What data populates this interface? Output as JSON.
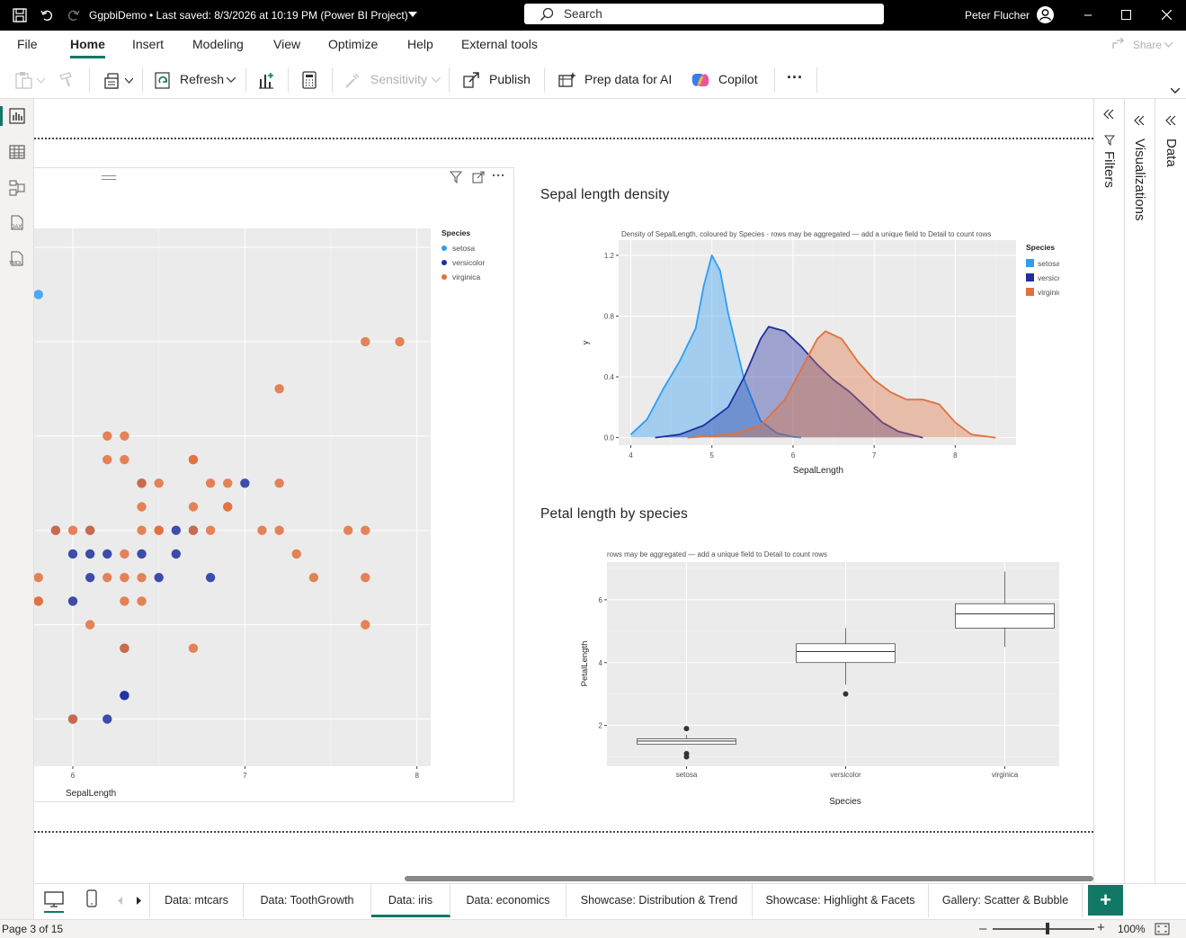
{
  "titlebar": {
    "doc": "GgpbiDemo",
    "saved": "• Last saved: 8/3/2026 at 10:19 PM (Power BI Project)",
    "search_placeholder": "Search",
    "user": "Peter Flucher"
  },
  "menu": {
    "items": [
      "File",
      "Home",
      "Insert",
      "Modeling",
      "View",
      "Optimize",
      "Help",
      "External tools"
    ],
    "share": "Share"
  },
  "ribbon": {
    "refresh": "Refresh",
    "sensitivity": "Sensitivity",
    "publish": "Publish",
    "prep": "Prep data for AI",
    "copilot": "Copilot",
    "more": "···"
  },
  "panes": {
    "filters": "Filters",
    "visualizations": "Visualizations",
    "data": "Data"
  },
  "left_rail": [
    "report-view-icon",
    "table-view-icon",
    "model-view-icon",
    "dax-query-icon",
    "tmdl-view-icon"
  ],
  "visual1": {
    "xlabel": "SepalLength",
    "legend_title": "Species",
    "legend": [
      "setosa",
      "versicolor",
      "virginica"
    ],
    "xticks": [
      "6",
      "7",
      "8"
    ]
  },
  "visual2": {
    "title": "Sepal length density",
    "subtitle": "Density of SepalLength, coloured by Species - rows may be aggregated — add a unique field to Detail to count rows",
    "xlabel": "SepalLength",
    "ylabel": "y",
    "legend_title": "Species",
    "legend": [
      "setosa",
      "versicolor",
      "virginica"
    ]
  },
  "visual3": {
    "title": "Petal length by species",
    "subtitle": "rows may be aggregated — add a unique field to Detail to count rows",
    "xlabel": "Species",
    "ylabel": "PetalLength"
  },
  "colors": {
    "setosa": "#2e9ef4",
    "versicolor": "#1f2fa0",
    "virginica": "#e2703c",
    "panel": "#ebebeb",
    "accent": "#117865"
  },
  "chart_data": [
    {
      "type": "scatter",
      "xlabel": "SepalLength",
      "xlim": [
        5.77,
        8.08
      ],
      "legend_title": "Species",
      "legend_position": "right",
      "series": [
        {
          "name": "setosa",
          "points": [
            [
              5.8,
              4.0
            ]
          ]
        },
        {
          "name": "versicolor",
          "points": [
            [
              6.0,
              2.2
            ],
            [
              6.0,
              2.7
            ],
            [
              6.0,
              2.9
            ],
            [
              6.1,
              2.8
            ],
            [
              6.1,
              2.9
            ],
            [
              6.1,
              3.0
            ],
            [
              6.2,
              2.2
            ],
            [
              6.2,
              2.9
            ],
            [
              6.3,
              2.3
            ],
            [
              6.3,
              2.5
            ],
            [
              6.4,
              2.9
            ],
            [
              6.5,
              2.8
            ],
            [
              6.6,
              2.9
            ],
            [
              6.6,
              3.0
            ],
            [
              6.7,
              3.0
            ],
            [
              6.8,
              2.8
            ],
            [
              7.0,
              3.2
            ],
            [
              5.9,
              3.0
            ],
            [
              6.4,
              3.2
            ],
            [
              6.3,
              2.3
            ]
          ]
        },
        {
          "name": "virginica",
          "points": [
            [
              6.3,
              3.3
            ],
            [
              5.8,
              2.7
            ],
            [
              7.1,
              3.0
            ],
            [
              6.3,
              2.9
            ],
            [
              6.5,
              3.0
            ],
            [
              7.6,
              3.0
            ],
            [
              7.3,
              2.9
            ],
            [
              6.7,
              2.5
            ],
            [
              7.2,
              3.6
            ],
            [
              6.5,
              3.2
            ],
            [
              6.4,
              2.7
            ],
            [
              6.8,
              3.0
            ],
            [
              5.8,
              2.8
            ],
            [
              6.4,
              3.2
            ],
            [
              6.5,
              3.0
            ],
            [
              7.7,
              3.8
            ],
            [
              7.7,
              2.6
            ],
            [
              6.0,
              2.2
            ],
            [
              6.9,
              3.2
            ],
            [
              7.7,
              2.8
            ],
            [
              6.3,
              2.7
            ],
            [
              6.7,
              3.3
            ],
            [
              7.2,
              3.2
            ],
            [
              6.2,
              2.8
            ],
            [
              6.1,
              3.0
            ],
            [
              6.4,
              2.8
            ],
            [
              7.2,
              3.0
            ],
            [
              7.4,
              2.8
            ],
            [
              7.9,
              3.8
            ],
            [
              6.3,
              2.8
            ],
            [
              6.1,
              2.6
            ],
            [
              7.7,
              3.0
            ],
            [
              6.3,
              3.4
            ],
            [
              6.4,
              3.1
            ],
            [
              6.0,
              3.0
            ],
            [
              6.9,
              3.1
            ],
            [
              6.7,
              3.1
            ],
            [
              6.9,
              3.1
            ],
            [
              5.8,
              2.7
            ],
            [
              6.8,
              3.2
            ],
            [
              6.7,
              3.3
            ],
            [
              6.7,
              3.0
            ],
            [
              6.3,
              2.5
            ],
            [
              6.5,
              3.0
            ],
            [
              6.2,
              3.4
            ],
            [
              5.9,
              3.0
            ],
            [
              6.2,
              3.3
            ],
            [
              6.4,
              3.0
            ]
          ]
        }
      ]
    },
    {
      "type": "area",
      "title": "Density of SepalLength, coloured by Species - rows may be aggregated — add a unique field to Detail to count rows",
      "xlabel": "SepalLength",
      "ylabel": "y",
      "xlim": [
        3.85,
        8.75
      ],
      "ylim": [
        -0.05,
        1.3
      ],
      "xticks": [
        4,
        5,
        6,
        7,
        8
      ],
      "yticks": [
        0.0,
        0.4,
        0.8,
        1.2
      ],
      "series": [
        {
          "name": "setosa",
          "x": [
            4.0,
            4.2,
            4.4,
            4.6,
            4.8,
            4.9,
            5.0,
            5.1,
            5.2,
            5.4,
            5.6,
            5.8,
            6.0,
            6.1
          ],
          "y": [
            0.02,
            0.12,
            0.32,
            0.5,
            0.72,
            1.0,
            1.2,
            1.1,
            0.82,
            0.38,
            0.11,
            0.03,
            0.005,
            0.0
          ]
        },
        {
          "name": "versicolor",
          "x": [
            4.3,
            4.6,
            4.9,
            5.2,
            5.4,
            5.6,
            5.7,
            5.9,
            6.1,
            6.3,
            6.5,
            6.7,
            6.9,
            7.1,
            7.3,
            7.6
          ],
          "y": [
            0.0,
            0.02,
            0.08,
            0.2,
            0.4,
            0.65,
            0.73,
            0.7,
            0.6,
            0.48,
            0.38,
            0.3,
            0.2,
            0.1,
            0.04,
            0.0
          ]
        },
        {
          "name": "virginica",
          "x": [
            4.7,
            5.0,
            5.3,
            5.6,
            5.9,
            6.1,
            6.3,
            6.4,
            6.6,
            6.8,
            7.0,
            7.2,
            7.4,
            7.6,
            7.8,
            8.0,
            8.2,
            8.5
          ],
          "y": [
            0.0,
            0.01,
            0.03,
            0.08,
            0.25,
            0.45,
            0.65,
            0.7,
            0.65,
            0.5,
            0.38,
            0.3,
            0.25,
            0.25,
            0.22,
            0.1,
            0.02,
            0.0
          ]
        }
      ]
    },
    {
      "type": "box",
      "title": "rows may be aggregated — add a unique field to Detail to count rows",
      "xlabel": "Species",
      "ylabel": "PetalLength",
      "ylim": [
        0.7,
        7.2
      ],
      "yticks": [
        2,
        4,
        6
      ],
      "categories": [
        "setosa",
        "versicolor",
        "virginica"
      ],
      "boxes": [
        {
          "min": 1.4,
          "q1": 1.4,
          "median": 1.5,
          "q3": 1.575,
          "max": 1.7,
          "outliers": [
            1.9,
            1.1,
            1.0
          ]
        },
        {
          "min": 3.3,
          "q1": 4.0,
          "median": 4.35,
          "q3": 4.6,
          "max": 5.1,
          "outliers": [
            3.0
          ]
        },
        {
          "min": 4.5,
          "q1": 5.1,
          "median": 5.55,
          "q3": 5.875,
          "max": 6.9,
          "outliers": []
        }
      ]
    }
  ],
  "tabs": [
    "Data: mtcars",
    "Data: ToothGrowth",
    "Data: iris",
    "Data: economics",
    "Showcase: Distribution & Trend",
    "Showcase: Highlight & Facets",
    "Gallery: Scatter & Bubble"
  ],
  "active_tab": "Data: iris",
  "status": {
    "page": "Page 3 of 15",
    "zoom": "100%",
    "zoom_level": 1.0
  }
}
